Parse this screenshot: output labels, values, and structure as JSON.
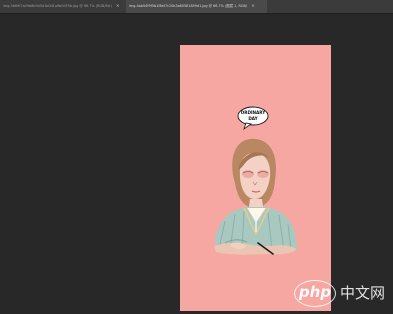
{
  "tabs": [
    {
      "title": "img-9b89f7a09b8b9d5d1b0d1a9b0d55b.jpg @ 66.7% (RGB/8#)",
      "close": "×",
      "active": false
    },
    {
      "title": "img-4ab54f9f5b1f8ef7c20b3a60581859d1.jpg @ 66.7% (图层 1, RGB/8#)",
      "close": "×",
      "active": true
    }
  ],
  "artwork": {
    "speech_bubble_line1": "ORDINARY",
    "speech_bubble_line2": "DAY"
  },
  "watermark": {
    "logo": "php",
    "text": "中文网"
  },
  "colors": {
    "workspace": "#282828",
    "tabbar": "#3b3b3b",
    "canvas": "#f6a7a2",
    "sweater": "#a9c8c0",
    "hair": "#b98862"
  }
}
